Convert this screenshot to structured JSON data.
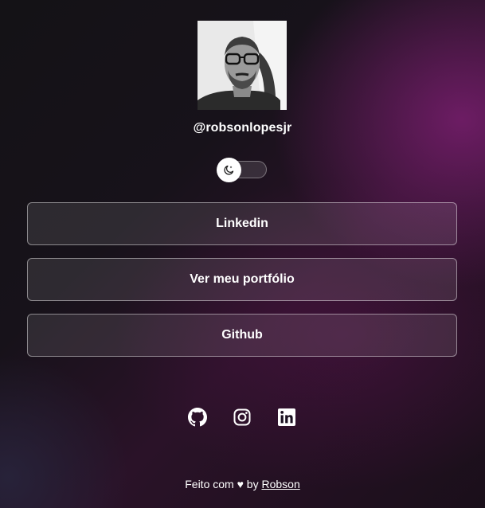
{
  "profile": {
    "handle": "@robsonlopesjr",
    "avatar_icon": "profile-photo"
  },
  "theme_toggle": {
    "icon": "moon-icon",
    "state": "dark"
  },
  "links": [
    {
      "label": "Linkedin"
    },
    {
      "label": "Ver meu portfólio"
    },
    {
      "label": "Github"
    }
  ],
  "social": [
    {
      "icon": "github-icon"
    },
    {
      "icon": "instagram-icon"
    },
    {
      "icon": "linkedin-icon"
    }
  ],
  "footer": {
    "prefix": "Feito com",
    "heart": "♥",
    "by": "by",
    "author": "Robson"
  },
  "colors": {
    "accent": "#6b2563",
    "text": "#ffffff"
  }
}
